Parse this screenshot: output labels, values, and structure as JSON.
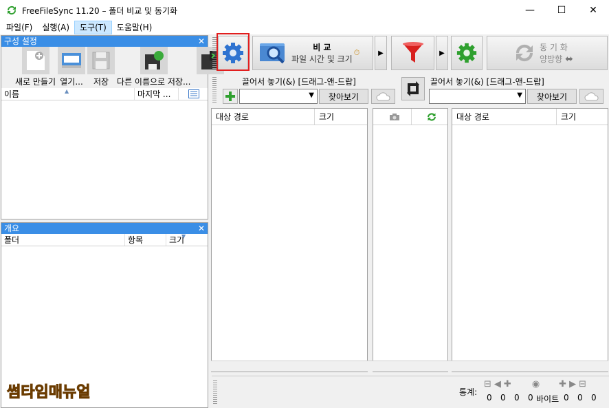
{
  "window": {
    "title": "FreeFileSync 11.20 – 폴더 비교 및 동기화",
    "minimize": "—",
    "maximize": "☐",
    "close": "✕"
  },
  "menu": [
    {
      "label": "파일(F)",
      "active": false
    },
    {
      "label": "실행(A)",
      "active": false
    },
    {
      "label": "도구(T)",
      "active": true
    },
    {
      "label": "도움말(H)",
      "active": false
    }
  ],
  "config_panel": {
    "title": "구성 설정",
    "close": "✕",
    "tools": [
      {
        "label": "새로 만들기",
        "icon": "new-config-icon"
      },
      {
        "label": "열기...",
        "icon": "open-config-icon"
      },
      {
        "label": "저장",
        "icon": "save-icon"
      },
      {
        "label": "다른 이름으로 저장...",
        "icon": "save-as-icon"
      },
      {
        "label": "",
        "icon": "save-batch-icon"
      }
    ],
    "col_name": "이름",
    "col_last": "마지막 ..."
  },
  "overview_panel": {
    "title": "개요",
    "close": "✕",
    "col_folder": "폴더",
    "col_items": "항목",
    "col_size": "크기"
  },
  "toolbar": {
    "compare_label": "비  교",
    "compare_sub": "파일 시간 및 크기",
    "sync_label": "동  기  화",
    "sync_sub": "양방향"
  },
  "left_folder": {
    "dnd_label": "끌어서 놓기(&) [드래그-앤-드랍]",
    "browse": "찾아보기",
    "value": ""
  },
  "right_folder": {
    "dnd_label": "끌어서 놓기(&) [드래그-앤-드랍]",
    "browse": "찾아보기",
    "value": ""
  },
  "grid": {
    "left_path": "대상 경로",
    "left_size": "크기",
    "right_path": "대상 경로",
    "right_size": "크기"
  },
  "status": {
    "label": "통계:",
    "counts": [
      "0",
      "0",
      "0",
      "0",
      "0",
      "0",
      "0"
    ],
    "bytes": "바이트"
  },
  "watermark": "썸타임매뉴얼",
  "colors": {
    "accent": "#3a8ee6",
    "highlight": "#e21e1e",
    "watermark": "#f6b800"
  }
}
